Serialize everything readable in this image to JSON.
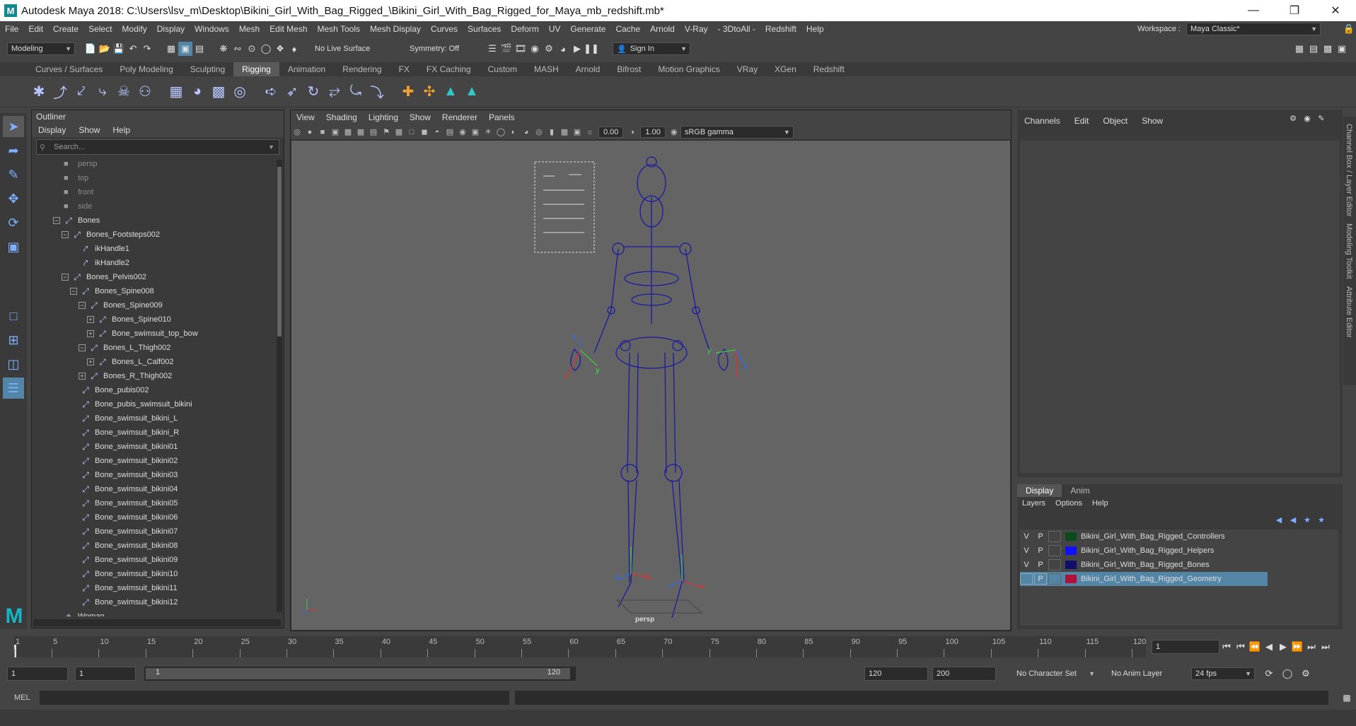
{
  "window": {
    "title": "Autodesk Maya 2018: C:\\Users\\lsv_m\\Desktop\\Bikini_Girl_With_Bag_Rigged_\\Bikini_Girl_With_Bag_Rigged_for_Maya_mb_redshift.mb*",
    "logo": "M"
  },
  "menus": [
    "File",
    "Edit",
    "Create",
    "Select",
    "Modify",
    "Display",
    "Windows",
    "Mesh",
    "Edit Mesh",
    "Mesh Tools",
    "Mesh Display",
    "Curves",
    "Surfaces",
    "Deform",
    "UV",
    "Generate",
    "Cache",
    "Arnold",
    "V-Ray",
    "- 3DtoAll -",
    "Redshift",
    "Help"
  ],
  "workspace": {
    "label": "Workspace :",
    "value": "Maya Classic*"
  },
  "status_line": {
    "mode": "Modeling",
    "live_surface": "No Live Surface",
    "symmetry": "Symmetry: Off",
    "sign_in": "Sign In"
  },
  "shelf_tabs": [
    "Curves / Surfaces",
    "Poly Modeling",
    "Sculpting",
    "Rigging",
    "Animation",
    "Rendering",
    "FX",
    "FX Caching",
    "Custom",
    "MASH",
    "Arnold",
    "Bifrost",
    "Motion Graphics",
    "VRay",
    "XGen",
    "Redshift"
  ],
  "active_shelf_tab": "Rigging",
  "outliner": {
    "title": "Outliner",
    "menu": [
      "Display",
      "Show",
      "Help"
    ],
    "search_placeholder": "Search...",
    "items": [
      {
        "label": "persp",
        "indent": 0,
        "type": "cam",
        "dim": true
      },
      {
        "label": "top",
        "indent": 0,
        "type": "cam",
        "dim": true
      },
      {
        "label": "front",
        "indent": 0,
        "type": "cam",
        "dim": true
      },
      {
        "label": "side",
        "indent": 0,
        "type": "cam",
        "dim": true
      },
      {
        "label": "Bones",
        "indent": 0,
        "exp": "-",
        "type": "joint"
      },
      {
        "label": "Bones_Footsteps002",
        "indent": 1,
        "exp": "-",
        "type": "joint"
      },
      {
        "label": "ikHandle1",
        "indent": 2,
        "exp": "",
        "type": "ik"
      },
      {
        "label": "ikHandle2",
        "indent": 2,
        "exp": "",
        "type": "ik"
      },
      {
        "label": "Bones_Pelvis002",
        "indent": 1,
        "exp": "-",
        "type": "joint"
      },
      {
        "label": "Bones_Spine008",
        "indent": 2,
        "exp": "-",
        "type": "joint"
      },
      {
        "label": "Bones_Spine009",
        "indent": 3,
        "exp": "-",
        "type": "joint"
      },
      {
        "label": "Bones_Spine010",
        "indent": 4,
        "exp": "+",
        "type": "joint"
      },
      {
        "label": "Bone_swimsuit_top_bow",
        "indent": 4,
        "exp": "+",
        "type": "joint"
      },
      {
        "label": "Bones_L_Thigh002",
        "indent": 3,
        "exp": "-",
        "type": "joint"
      },
      {
        "label": "Bones_L_Calf002",
        "indent": 4,
        "exp": "+",
        "type": "joint"
      },
      {
        "label": "Bones_R_Thigh002",
        "indent": 3,
        "exp": "+",
        "type": "joint"
      },
      {
        "label": "Bone_pubis002",
        "indent": 2,
        "exp": "",
        "type": "joint"
      },
      {
        "label": "Bone_pubis_swimsuit_bikini",
        "indent": 2,
        "exp": "",
        "type": "joint"
      },
      {
        "label": "Bone_swimsuit_bikini_L",
        "indent": 2,
        "exp": "",
        "type": "joint"
      },
      {
        "label": "Bone_swimsuit_bikini_R",
        "indent": 2,
        "exp": "",
        "type": "joint"
      },
      {
        "label": "Bone_swimsuit_bikini01",
        "indent": 2,
        "exp": "",
        "type": "joint"
      },
      {
        "label": "Bone_swimsuit_bikini02",
        "indent": 2,
        "exp": "",
        "type": "joint"
      },
      {
        "label": "Bone_swimsuit_bikini03",
        "indent": 2,
        "exp": "",
        "type": "joint"
      },
      {
        "label": "Bone_swimsuit_bikini04",
        "indent": 2,
        "exp": "",
        "type": "joint"
      },
      {
        "label": "Bone_swimsuit_bikini05",
        "indent": 2,
        "exp": "",
        "type": "joint"
      },
      {
        "label": "Bone_swimsuit_bikini06",
        "indent": 2,
        "exp": "",
        "type": "joint"
      },
      {
        "label": "Bone_swimsuit_bikini07",
        "indent": 2,
        "exp": "",
        "type": "joint"
      },
      {
        "label": "Bone_swimsuit_bikini08",
        "indent": 2,
        "exp": "",
        "type": "joint"
      },
      {
        "label": "Bone_swimsuit_bikini09",
        "indent": 2,
        "exp": "",
        "type": "joint"
      },
      {
        "label": "Bone_swimsuit_bikini10",
        "indent": 2,
        "exp": "",
        "type": "joint"
      },
      {
        "label": "Bone_swimsuit_bikini11",
        "indent": 2,
        "exp": "",
        "type": "joint"
      },
      {
        "label": "Bone_swimsuit_bikini12",
        "indent": 2,
        "exp": "",
        "type": "joint"
      },
      {
        "label": "Woman",
        "indent": 0,
        "exp": "",
        "type": "mesh"
      }
    ]
  },
  "viewport": {
    "menu": [
      "View",
      "Shading",
      "Lighting",
      "Show",
      "Renderer",
      "Panels"
    ],
    "exposure": "0.00",
    "gamma": "1.00",
    "color_space": "sRGB gamma",
    "camera_label": "persp",
    "axis_labels": {
      "x": "x",
      "y": "y",
      "z": "z"
    }
  },
  "channel_box": {
    "menu": [
      "Channels",
      "Edit",
      "Object",
      "Show"
    ]
  },
  "layer_editor": {
    "tabs": [
      "Display",
      "Anim"
    ],
    "active_tab": "Display",
    "menu": [
      "Layers",
      "Options",
      "Help"
    ],
    "layers": [
      {
        "v": "V",
        "p": "P",
        "color": "#0d4a1a",
        "name": "Bikini_Girl_With_Bag_Rigged_Controllers",
        "selected": false
      },
      {
        "v": "V",
        "p": "P",
        "color": "#1010ff",
        "name": "Bikini_Girl_With_Bag_Rigged_Helpers",
        "selected": false
      },
      {
        "v": "V",
        "p": "P",
        "color": "#10106a",
        "name": "Bikini_Girl_With_Bag_Rigged_Bones",
        "selected": false
      },
      {
        "v": "",
        "p": "P",
        "color": "#b0103a",
        "name": "Bikini_Girl_With_Bag_Rigged_Geometry",
        "selected": true
      }
    ]
  },
  "side_tabs": [
    "Channel Box / Layer Editor",
    "Modeling Toolkit",
    "Attribute Editor"
  ],
  "timeline": {
    "ticks": [
      "1",
      "5",
      "10",
      "15",
      "20",
      "25",
      "30",
      "35",
      "40",
      "45",
      "50",
      "55",
      "60",
      "65",
      "70",
      "75",
      "80",
      "85",
      "90",
      "95",
      "100",
      "105",
      "110",
      "115",
      "120"
    ],
    "current_frame": "1"
  },
  "range": {
    "start": "1",
    "playback_start": "1",
    "slider_start": "1",
    "slider_end": "120",
    "playback_end": "120",
    "end": "200",
    "character_set": "No Character Set",
    "anim_layer": "No Anim Layer",
    "fps": "24 fps"
  },
  "command_line": {
    "label": "MEL"
  }
}
